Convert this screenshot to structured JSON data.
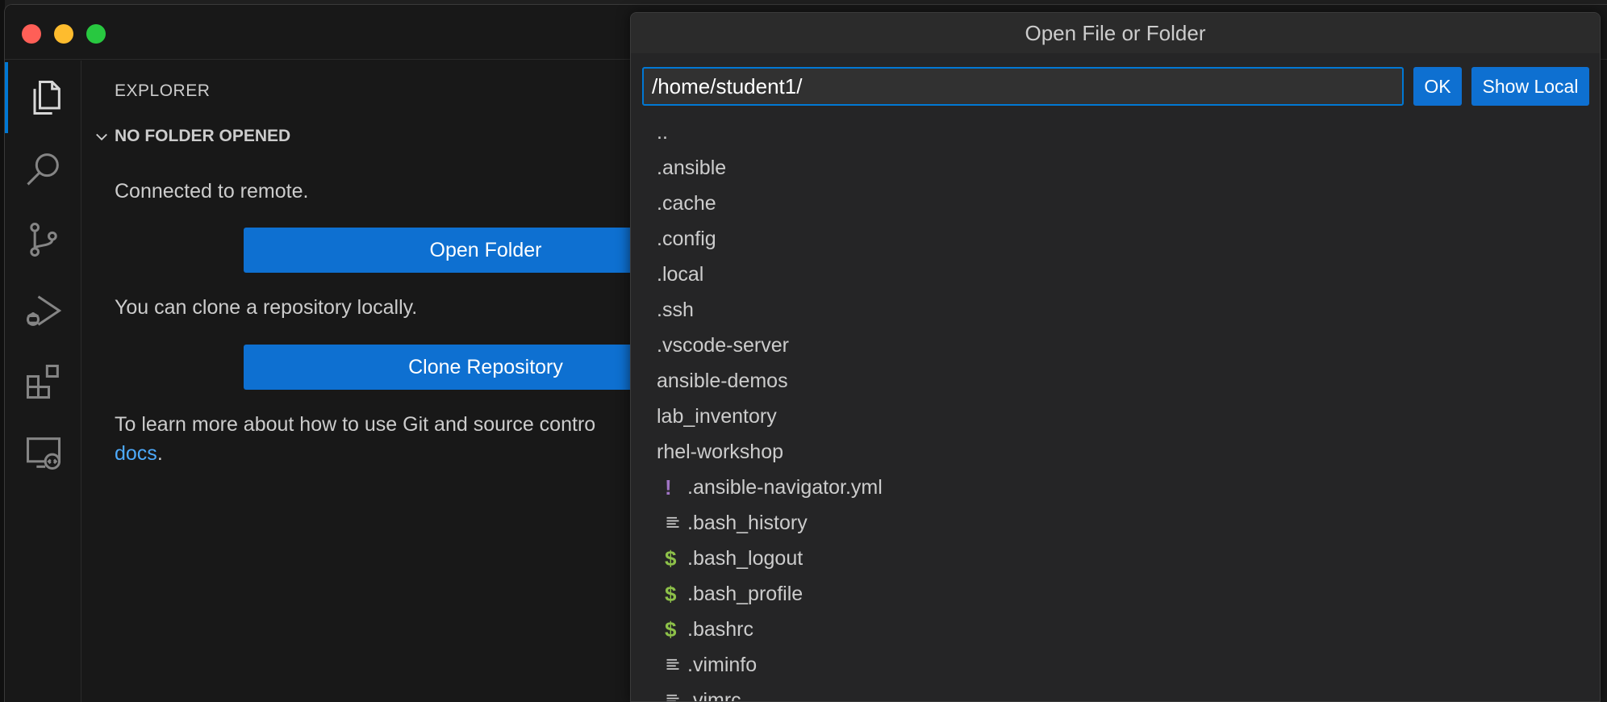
{
  "sidebar": {
    "title": "EXPLORER",
    "section": "NO FOLDER OPENED",
    "connected_text": "Connected to remote.",
    "open_folder_label": "Open Folder",
    "clone_text": "You can clone a repository locally.",
    "clone_label": "Clone Repository",
    "learn_text": "To learn more about how to use Git and source contro",
    "docs_link": "docs",
    "docs_suffix": "."
  },
  "activity_icons": [
    "files-icon",
    "search-icon",
    "source-control-icon",
    "run-debug-icon",
    "extensions-icon",
    "remote-explorer-icon"
  ],
  "dialog": {
    "title": "Open File or Folder",
    "path_value": "/home/student1/",
    "ok_label": "OK",
    "show_local_label": "Show Local",
    "folders": [
      "..",
      ".ansible",
      ".cache",
      ".config",
      ".local",
      ".ssh",
      ".vscode-server",
      "ansible-demos",
      "lab_inventory",
      "rhel-workshop"
    ],
    "files": [
      {
        "name": ".ansible-navigator.yml",
        "icon": "yaml-icon",
        "glyph": "!"
      },
      {
        "name": ".bash_history",
        "icon": "text-file-icon",
        "glyph": ""
      },
      {
        "name": ".bash_logout",
        "icon": "shell-icon",
        "glyph": "$"
      },
      {
        "name": ".bash_profile",
        "icon": "shell-icon",
        "glyph": "$"
      },
      {
        "name": ".bashrc",
        "icon": "shell-icon",
        "glyph": "$"
      },
      {
        "name": ".viminfo",
        "icon": "text-file-icon",
        "glyph": ""
      },
      {
        "name": ".vimrc",
        "icon": "text-file-icon",
        "glyph": ""
      }
    ]
  },
  "colors": {
    "accent": "#0078d4",
    "button": "#0e70d1",
    "link": "#4daafc",
    "yaml": "#a074c4",
    "shell": "#8dc149"
  }
}
